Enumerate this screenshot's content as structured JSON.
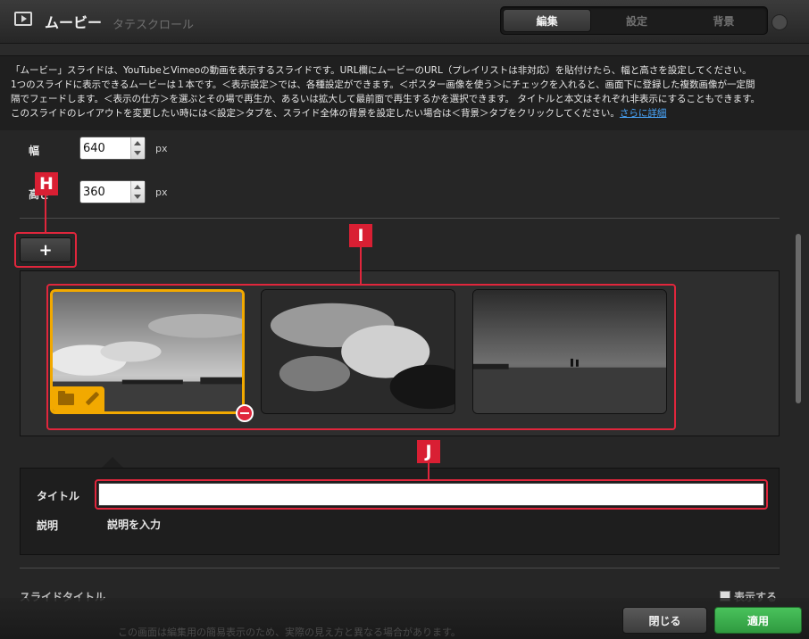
{
  "header": {
    "title": "ムービー",
    "background_text": "タテスクロール",
    "tabs": [
      {
        "label": "編集",
        "active": true
      },
      {
        "label": "設定",
        "active": false
      },
      {
        "label": "背景",
        "active": false
      }
    ]
  },
  "description": {
    "text": "「ムービー」スライドは、YouTubeとVimeoの動画を表示するスライドです。URL欄にムービーのURL（プレイリストは非対応）を貼付けたら、幅と高さを設定してください。\n1つのスライドに表示できるムービーは１本です。＜表示設定＞では、各種設定ができます。＜ポスター画像を使う＞にチェックを入れると、画面下に登録した複数画像が一定間\n隔でフェードします。＜表示の仕方＞を選ぶとその場で再生か、あるいは拡大して最前面で再生するかを選択できます。 タイトルと本文はそれぞれ非表示にすることもできます。\nこのスライドのレイアウトを変更したい時には＜設定＞タブを、スライド全体の背景を設定したい場合は＜背景＞タブをクリックしてください。",
    "link": "さらに詳細"
  },
  "size": {
    "width_label": "幅",
    "width_value": "640",
    "height_label": "高さ",
    "height_value": "360",
    "unit": "px"
  },
  "add_button": {
    "label": "+"
  },
  "callouts": {
    "h": "H",
    "i": "I",
    "j": "J"
  },
  "thumbnails": [
    {
      "selected": true
    },
    {
      "selected": false
    },
    {
      "selected": false
    }
  ],
  "detail": {
    "title_label": "タイトル",
    "title_value": "",
    "description_label": "説明",
    "description_placeholder": "説明を入力"
  },
  "bottom": {
    "slide_title_label": "スライドタイトル",
    "show_label": "表示する"
  },
  "footer": {
    "note": "この画面は編集用の簡易表示のため、実際の見え方と異なる場合があります。",
    "close_label": "閉じる",
    "apply_label": "適用"
  },
  "colors": {
    "accent": "#f2a900",
    "callout": "#e0263c",
    "apply": "#3aad4c",
    "link": "#4aa8ff"
  }
}
